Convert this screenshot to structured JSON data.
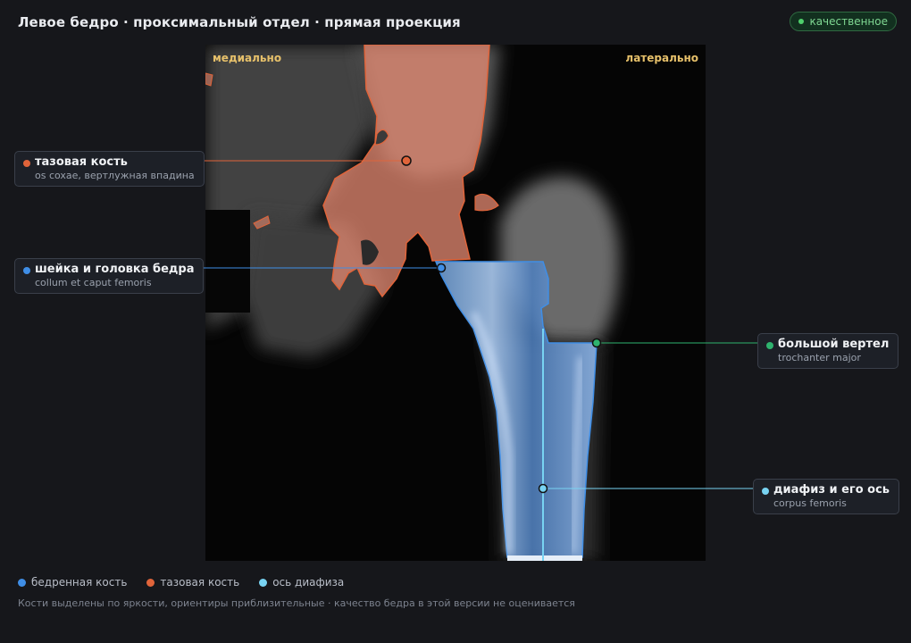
{
  "header": {
    "title": "Левое бедро · проксимальный отдел · прямая проекция",
    "badge": "качественное"
  },
  "viewer": {
    "orient_left": "медиально",
    "orient_right": "латерально"
  },
  "callouts": {
    "pelvis": {
      "name": "тазовая кость",
      "latin": "os coxae, вертлужная впадина"
    },
    "neck": {
      "name": "шейка и головка бедра",
      "latin": "collum et caput femoris"
    },
    "trochanter": {
      "name": "большой вертел",
      "latin": "trochanter major"
    },
    "shaft": {
      "name": "диафиз и его ось",
      "latin": "corpus femoris"
    }
  },
  "legend": [
    {
      "label": "бедренная кость"
    },
    {
      "label": "тазовая кость"
    },
    {
      "label": "ось диафиза"
    }
  ],
  "footnote": "Кости выделены по яркости, ориентиры приблизительные · качество бедра в этой версии не оценивается",
  "colors": {
    "femur": "#3f8ee6",
    "pelvis": "#e0643a",
    "axis": "#78d3f2",
    "trochanter": "#2fb36e",
    "badge": "#4fcf6c"
  }
}
